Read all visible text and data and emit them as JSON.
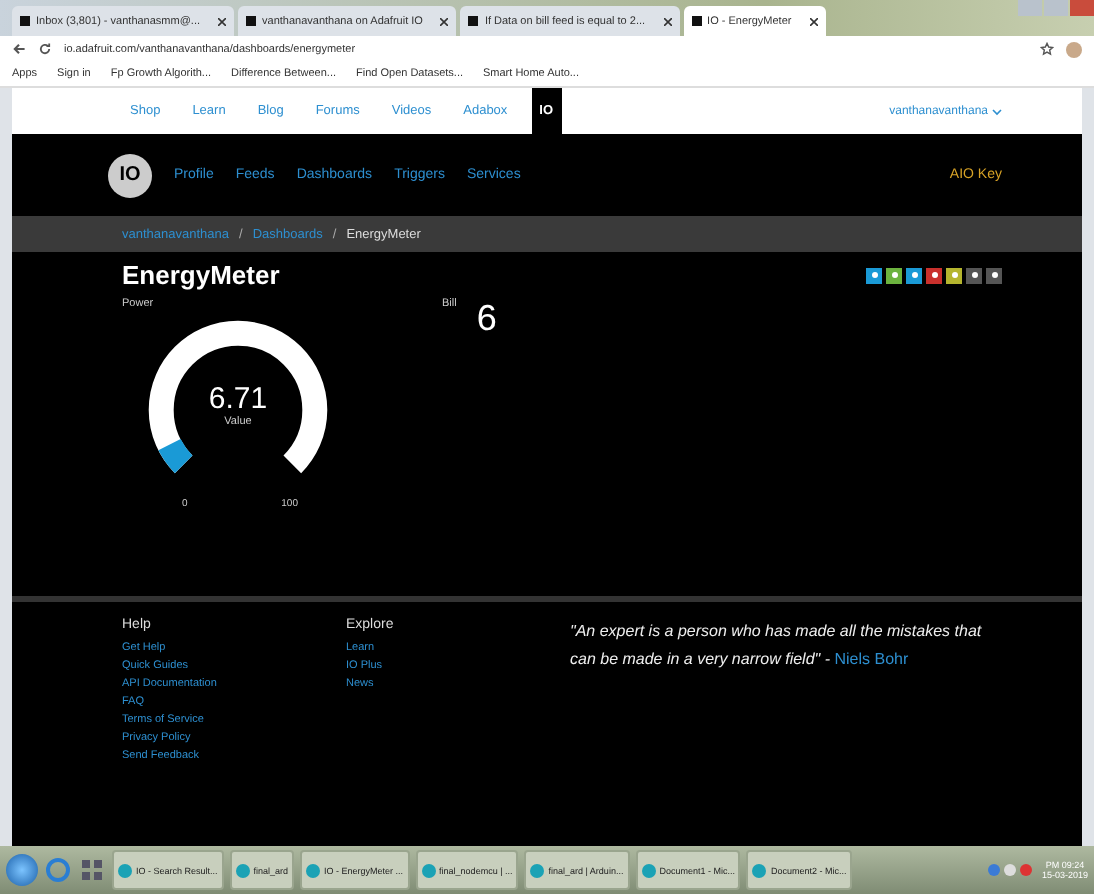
{
  "browser": {
    "tabs": [
      {
        "label": "Inbox (3,801) - vanthanasmm@...",
        "selected": false
      },
      {
        "label": "vanthanavanthana on Adafruit IO",
        "selected": false
      },
      {
        "label": "If Data on bill feed is equal to 2...",
        "selected": false
      },
      {
        "label": "IO - EnergyMeter",
        "selected": true
      }
    ],
    "address": "io.adafruit.com/vanthanavanthana/dashboards/energymeter",
    "bookmarks": [
      "Apps",
      "Sign in",
      "Fp Growth Algorith...",
      "Difference Between...",
      "Find Open Datasets...",
      "Smart Home Auto..."
    ]
  },
  "site_nav": {
    "links": [
      {
        "label": "Shop",
        "selected": false
      },
      {
        "label": "Learn",
        "selected": false
      },
      {
        "label": "Blog",
        "selected": false
      },
      {
        "label": "Forums",
        "selected": false
      },
      {
        "label": "Videos",
        "selected": false
      },
      {
        "label": "Adabox",
        "selected": false
      },
      {
        "label": "IO",
        "selected": true
      }
    ],
    "user": "vanthanavanthana"
  },
  "io_nav": {
    "logo": "IO",
    "links": [
      "Profile",
      "Feeds",
      "Dashboards",
      "Triggers",
      "Services"
    ],
    "key": "AIO Key"
  },
  "breadcrumb": [
    "vanthanavanthana",
    "Dashboards",
    "EnergyMeter"
  ],
  "breadcrumb_separator": "/",
  "dashboard": {
    "title": "EnergyMeter",
    "tools": [
      {
        "color": "#1a9ad6"
      },
      {
        "color": "#6cb33f"
      },
      {
        "color": "#1a9ad6"
      },
      {
        "color": "#c9302c"
      },
      {
        "color": "#b5b52e"
      },
      {
        "color": "#555555"
      },
      {
        "color": "#555555"
      }
    ],
    "gauge": {
      "title": "Power",
      "value": "6.71",
      "caption": "Value",
      "level": 0.0671,
      "min": "0",
      "max": "100"
    },
    "bill": {
      "title": "Bill",
      "value": "6"
    }
  },
  "footer": {
    "columns": [
      {
        "heading": "Help",
        "links": [
          "Get Help",
          "Quick Guides",
          "API Documentation",
          "FAQ",
          "Terms of Service",
          "Privacy Policy",
          "Send Feedback"
        ]
      },
      {
        "heading": "Explore",
        "links": [
          "Learn",
          "IO Plus",
          "News"
        ]
      }
    ],
    "quote": "\"An expert is a person who has made all the mistakes that can be made in a very narrow field\" - ",
    "author": "Niels Bohr"
  },
  "taskbar": {
    "items": [
      "IO - Search Result...",
      "final_ard",
      "IO - EnergyMeter ...",
      "final_nodemcu | ...",
      "final_ard | Arduin...",
      "Document1 - Mic...",
      "Document2 - Mic..."
    ],
    "time": "PM 09:24",
    "date": "15-03-2019"
  }
}
